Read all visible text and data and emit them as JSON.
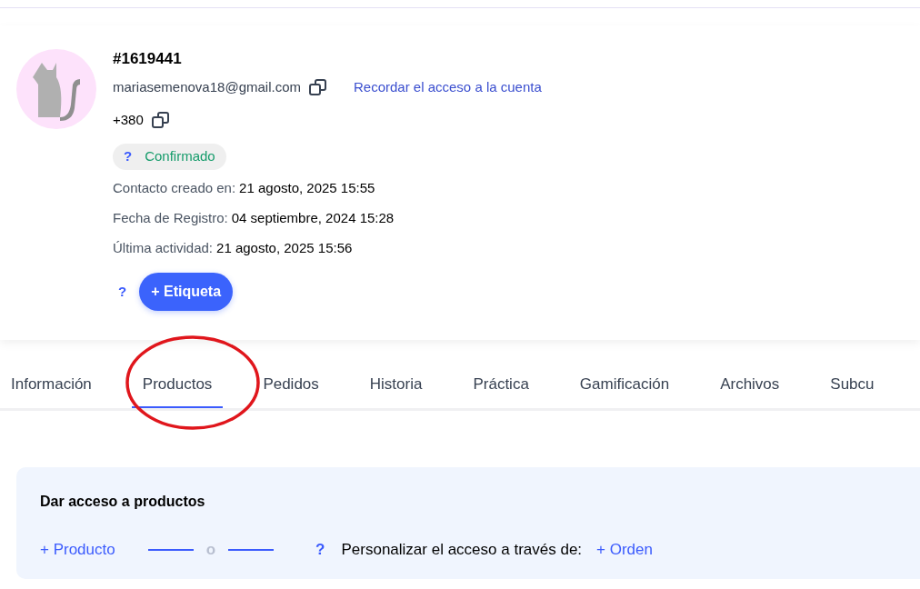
{
  "contact": {
    "id": "#1619441",
    "email": "mariasemenova18@gmail.com",
    "remind_link": "Recordar el acceso a la cuenta",
    "phone": "+380",
    "status": {
      "help": "?",
      "label": "Confirmado"
    },
    "details": [
      {
        "label": "Contacto creado en:",
        "value": "21 agosto, 2025 15:55"
      },
      {
        "label": "Fecha de Registro:",
        "value": "04 septiembre, 2024 15:28"
      },
      {
        "label": "Última actividad:",
        "value": "21 agosto, 2025 15:56"
      }
    ],
    "tag_help": "?",
    "tag_button": "+ Etiqueta"
  },
  "tabs": [
    {
      "label": "Información",
      "selected": false
    },
    {
      "label": "Productos",
      "selected": true
    },
    {
      "label": "Pedidos",
      "selected": false
    },
    {
      "label": "Historia",
      "selected": false
    },
    {
      "label": "Práctica",
      "selected": false
    },
    {
      "label": "Gamificación",
      "selected": false
    },
    {
      "label": "Archivos",
      "selected": false
    },
    {
      "label": "Subcu",
      "selected": false
    }
  ],
  "access": {
    "title": "Dar acceso a productos",
    "product_link": "+ Producto",
    "separator": "o",
    "help": "?",
    "customize_label": "Personalizar el acceso a través de:",
    "order_link": "+ Orden"
  }
}
